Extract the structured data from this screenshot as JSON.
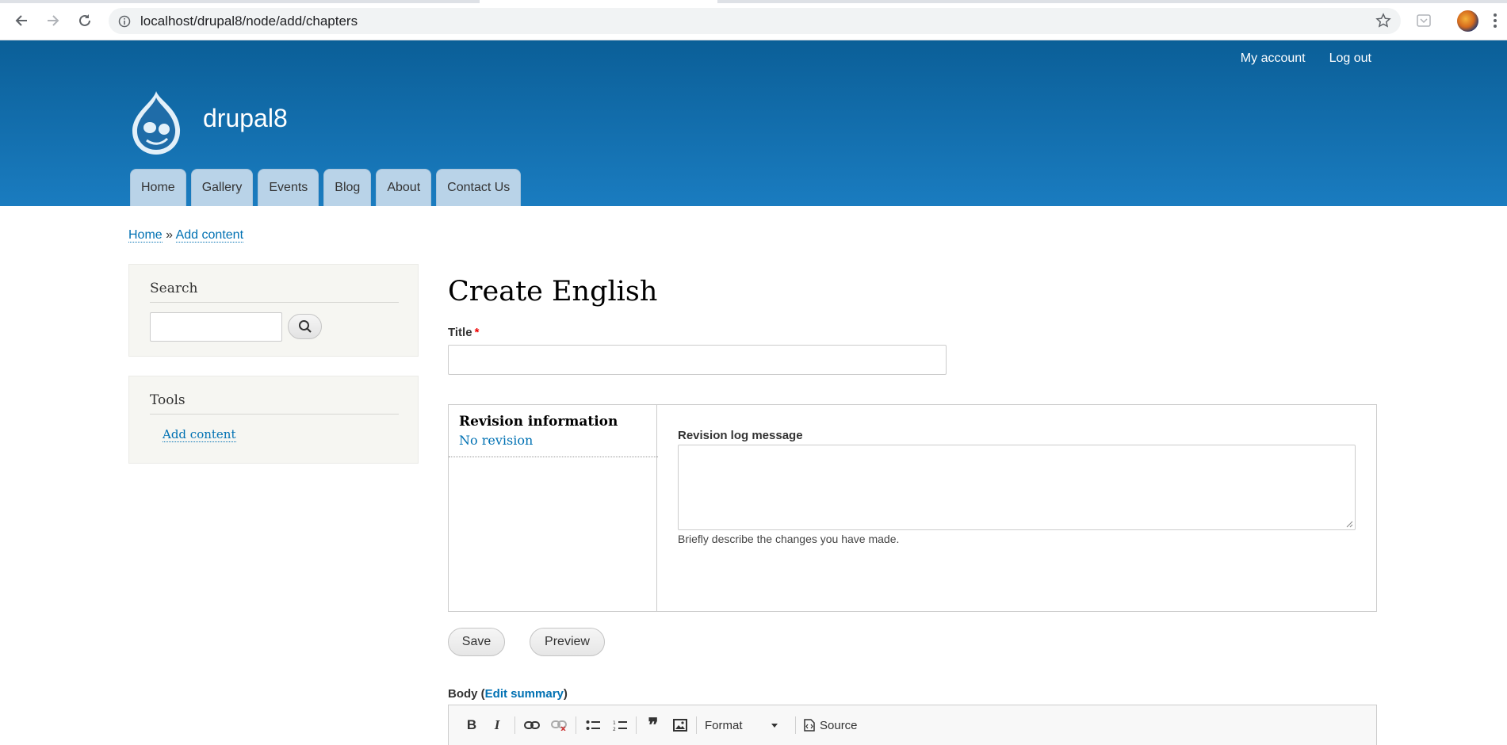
{
  "browser": {
    "url": "localhost/drupal8/node/add/chapters"
  },
  "header": {
    "site_name": "drupal8",
    "secondary_menu": [
      {
        "label": "My account"
      },
      {
        "label": "Log out"
      }
    ],
    "main_menu": [
      {
        "label": "Home"
      },
      {
        "label": "Gallery"
      },
      {
        "label": "Events"
      },
      {
        "label": "Blog"
      },
      {
        "label": "About"
      },
      {
        "label": "Contact Us"
      }
    ]
  },
  "breadcrumb": {
    "home": "Home",
    "separator": "»",
    "current": "Add content"
  },
  "sidebar": {
    "search_title": "Search",
    "tools_title": "Tools",
    "tools_link": "Add content"
  },
  "main": {
    "page_title": "Create English",
    "title_label": "Title",
    "required_mark": "*",
    "revision": {
      "tab_title": "Revision information",
      "tab_summary": "No revision",
      "log_label": "Revision log message",
      "log_help": "Briefly describe the changes you have made."
    },
    "actions": {
      "save": "Save",
      "preview": "Preview"
    },
    "body": {
      "label": "Body",
      "open_paren": "(",
      "edit_summary": "Edit summary",
      "close_paren": ")"
    },
    "toolbar": {
      "bold": "B",
      "italic": "I",
      "blockquote": "❞",
      "format": "Format",
      "source": "Source"
    }
  }
}
